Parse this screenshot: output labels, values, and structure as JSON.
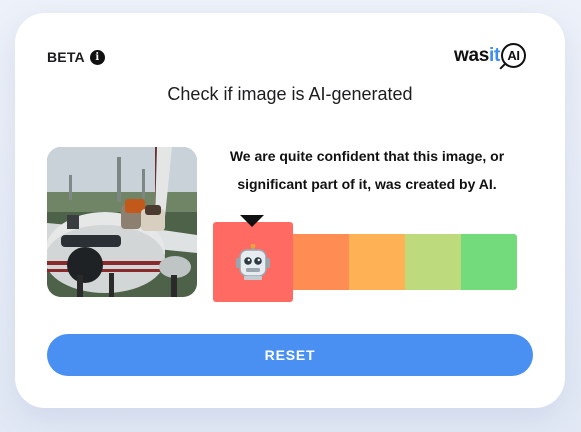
{
  "header": {
    "beta_label": "BETA",
    "info_icon": "info-icon",
    "logo": {
      "prefix": "was",
      "accent": "it",
      "badge": "AI"
    }
  },
  "main": {
    "headline": "Check if image is AI-generated",
    "image_alt": "airplane on runway",
    "verdict_line1": "We are quite confident that this image, or",
    "verdict_line2": "significant part of it, was created by AI."
  },
  "meter": {
    "active_index": 0,
    "active_icon": "robot-icon",
    "segments": [
      {
        "color": "#ff6a63"
      },
      {
        "color": "#ff8c52"
      },
      {
        "color": "#ffb155"
      },
      {
        "color": "#bddb7c"
      },
      {
        "color": "#74db7c"
      }
    ]
  },
  "actions": {
    "reset_label": "RESET"
  },
  "colors": {
    "accent": "#4a90f2",
    "logo_accent": "#3c8cf2"
  }
}
